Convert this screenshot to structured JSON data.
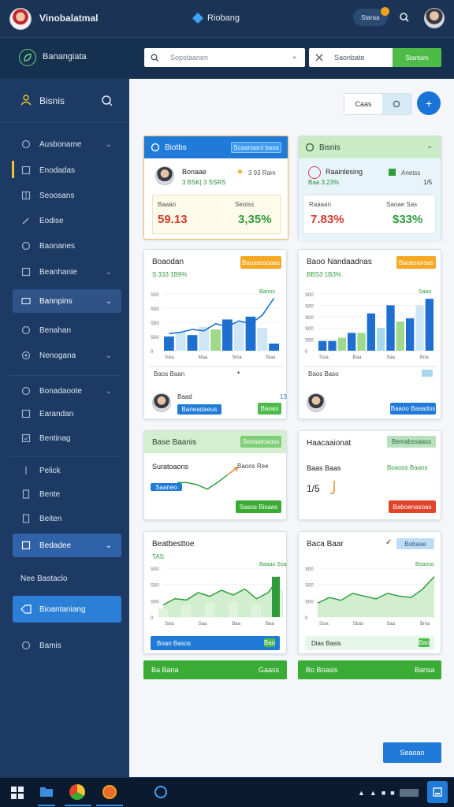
{
  "header": {
    "app_title": "Vinobalatmal",
    "center_title": "Riobang",
    "search_chip": "Staraa",
    "notification_count": ""
  },
  "subbar": {
    "brand": "Banangiata",
    "search_placeholder": "Sopstaanen",
    "filter_label": "Saonbate",
    "action_label": "Stantsm"
  },
  "sidebar": {
    "header": "Bisnis",
    "items": [
      {
        "label": "Ausboname",
        "chevron": true,
        "active": false
      },
      {
        "label": "Enodadas",
        "chevron": false,
        "active": false,
        "marker": true
      },
      {
        "label": "Seoosans",
        "chevron": false,
        "active": false
      },
      {
        "label": "Eodise",
        "chevron": false,
        "active": false
      },
      {
        "label": "Baonanes",
        "chevron": false,
        "active": false
      },
      {
        "label": "Beanhanie",
        "chevron": true,
        "active": false
      },
      {
        "label": "Bannpins",
        "chevron": true,
        "active": true
      },
      {
        "label": "Benahan",
        "chevron": false,
        "active": false
      },
      {
        "label": "Nenogana",
        "chevron": true,
        "active": false
      },
      {
        "label": "Bonadaoote",
        "chevron": true,
        "active": false
      },
      {
        "label": "Earandan",
        "chevron": false,
        "active": false
      },
      {
        "label": "Bentinag",
        "chevron": false,
        "active": false
      },
      {
        "label": "Pelick",
        "chevron": false,
        "active": false
      },
      {
        "label": "Bente",
        "chevron": false,
        "active": false
      },
      {
        "label": "Beiten",
        "chevron": false,
        "active": false
      },
      {
        "label": "Bedadee",
        "chevron": true,
        "active": true
      },
      {
        "label": "Nee Bastaclo",
        "chevron": false,
        "active": false
      },
      {
        "label": "Bioantaniang",
        "chevron": false,
        "active": true
      },
      {
        "label": "Bamis",
        "chevron": false,
        "active": false
      }
    ]
  },
  "toolbar": {
    "toggle_left": "Caas",
    "toggle_right": "",
    "fab": "+"
  },
  "cards": {
    "c1": {
      "title": "Biotbs",
      "header_btn": "Scaanaanl basa",
      "person_name": "Bonaae",
      "person_stat": "3 BSK| 3 SSRS",
      "person_tag": "3 93 Ram",
      "left_label": "Baaan",
      "left_value": "59.13",
      "right_label": "Seotss",
      "right_value": "3,35%"
    },
    "c2": {
      "title": "Bisnis",
      "person_name": "Raainlesing",
      "person_stat": "Baa 3.23%",
      "person_tag": "Anetss",
      "person_num": "1/5",
      "left_label": "Raaaan",
      "left_value": "7.83%",
      "right_label": "Saoae Sas",
      "right_value": "$33%"
    },
    "c3": {
      "title": "Boaodan",
      "subtitle": "S.333 1B9%",
      "badge": "Baosassoaas",
      "legend": "Banos",
      "footer_left": "Baos Baan",
      "footer_dot": "•",
      "person": "Baad",
      "person_btn": "Baneadaeus",
      "person_tag": "Baoas",
      "person_num": "13"
    },
    "c4": {
      "title": "Baoo Nandaadnas",
      "subtitle": "BBS3 1B3%",
      "badge": "Baoasansas",
      "legend": "Saao",
      "footer_left": "Baos Baso",
      "person_btn": "Baaoo Basados"
    },
    "c5": {
      "title": "Base Baanis",
      "badge": "Seoaatoaoss",
      "label": "Suratoaons",
      "value_label": "Baoos Ree",
      "blue_btn": "Saaneo",
      "green_btn": "Sasos Bisaas"
    },
    "c6": {
      "title": "Haacaaionat",
      "badge": "Bemabssaass",
      "label": "Baas Baas",
      "value_label": "Boaoss Baaos",
      "value": "1/5",
      "red_btn": "Baboenasoas"
    },
    "c7": {
      "title": "Beatbesttoe",
      "subtitle": "TAS",
      "legend": "Baaao Soa",
      "footer_btn": "Boan Basos",
      "footer_tag": "Bao"
    },
    "c8": {
      "title": "Baca Baar",
      "badge": "Bobaae",
      "legend": "Boaoso",
      "footer_btn": "Dias Basis",
      "footer_tag": "Bao"
    },
    "bar1_left": "Ba Bana",
    "bar1_right": "Gaass",
    "bar2_left": "Bo Boasis",
    "bar2_right": "Bansa"
  },
  "primary_button": "Seaoan",
  "chart_data": [
    {
      "type": "bar",
      "title": "Boaodan",
      "x_ticks": [
        "Ssia",
        "Maa",
        "Sma",
        "Staa"
      ],
      "y_ticks": [
        "S00",
        "S00",
        "S50",
        "S00",
        "0"
      ],
      "series": [
        {
          "values": [
            20,
            26,
            22,
            34,
            30,
            44,
            40,
            48,
            32,
            10
          ]
        }
      ],
      "line": [
        24,
        26,
        30,
        28,
        38,
        34,
        42,
        38,
        50,
        74
      ],
      "colors": [
        "#1f6fd1",
        "#cfe6f6",
        "#1f6fd1",
        "#cfe6f6",
        "#9fd98a",
        "#1f6fd1",
        "#cfe6f6",
        "#1f6fd1",
        "#cfe6f6",
        "#1f6fd1"
      ],
      "ylim": [
        0,
        80
      ]
    },
    {
      "type": "bar",
      "title": "Baoo Nandaadnas",
      "x_ticks": [
        "Ssia",
        "Baa",
        "Saa",
        "Boa"
      ],
      "y_ticks": [
        "S00",
        "S00",
        "S00",
        "S00",
        "S50",
        "0"
      ],
      "series": [
        {
          "values": [
            12,
            12,
            16,
            22,
            22,
            46,
            28,
            56,
            36,
            40,
            56,
            64
          ]
        }
      ],
      "colors": [
        "#1f6fd1",
        "#1f6fd1",
        "#9fd98a",
        "#1f6fd1",
        "#9fd98a",
        "#1f6fd1",
        "#a8d8f0",
        "#1f6fd1",
        "#9fd98a",
        "#1f6fd1",
        "#cfe6f6",
        "#1f6fd1"
      ],
      "ylim": [
        0,
        70
      ]
    },
    {
      "type": "area",
      "title": "Beatbesttoe",
      "x_ticks": [
        "Ssia",
        "Saa",
        "Baa",
        "Baa"
      ],
      "y_ticks": [
        "S00",
        "S00",
        "S00",
        "0"
      ],
      "series": [
        {
          "values": [
            20,
            30,
            28,
            40,
            34,
            44,
            36,
            46,
            30,
            40,
            66
          ]
        }
      ],
      "ylim": [
        0,
        80
      ]
    },
    {
      "type": "area",
      "title": "Baca Baar",
      "x_ticks": [
        "Ssia",
        "Sbas",
        "Saa",
        "Bma"
      ],
      "y_ticks": [
        "S00",
        "S00",
        "S00",
        "0"
      ],
      "series": [
        {
          "values": [
            20,
            28,
            24,
            34,
            30,
            26,
            34,
            30,
            28,
            40,
            58
          ]
        }
      ],
      "ylim": [
        0,
        70
      ]
    },
    {
      "type": "line",
      "title": "Suratoaons",
      "series": [
        {
          "values": [
            30,
            30,
            26,
            18,
            30,
            44,
            58
          ]
        }
      ],
      "ylim": [
        0,
        70
      ]
    }
  ]
}
